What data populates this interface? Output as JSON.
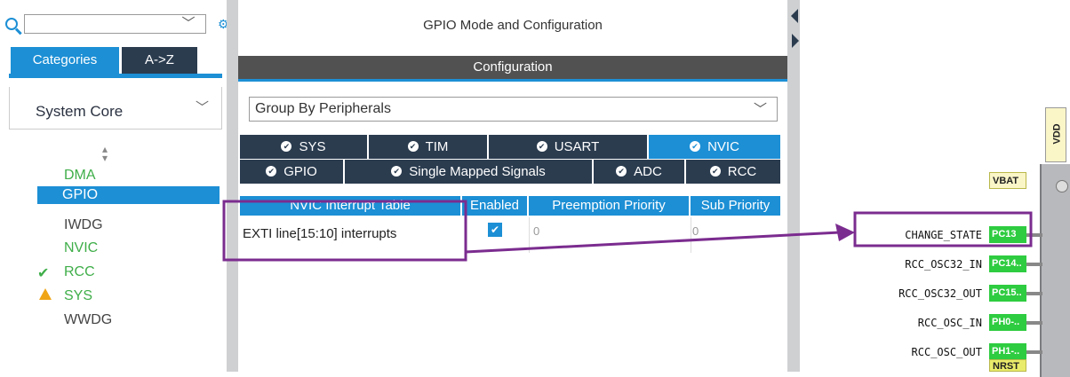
{
  "left_panel": {
    "tabs": {
      "categories": "Categories",
      "az": "A->Z"
    },
    "category_dropdown": "System Core",
    "items": [
      {
        "label": "DMA",
        "status": "none"
      },
      {
        "label": "GPIO",
        "status": "selected"
      },
      {
        "label": "IWDG",
        "status": "none"
      },
      {
        "label": "NVIC",
        "status": "none"
      },
      {
        "label": "RCC",
        "status": "ok"
      },
      {
        "label": "SYS",
        "status": "warning"
      },
      {
        "label": "WWDG",
        "status": "none"
      }
    ]
  },
  "main": {
    "title": "GPIO Mode and Configuration",
    "config_header": "Configuration",
    "group_by": "Group By Peripherals",
    "tabs_row1": [
      "SYS",
      "TIM",
      "USART",
      "NVIC"
    ],
    "tabs_row2": [
      "GPIO",
      "Single Mapped Signals",
      "ADC",
      "RCC"
    ],
    "active_tab": "NVIC",
    "table": {
      "columns": [
        "NVIC Interrupt Table",
        "Enabled",
        "Preemption Priority",
        "Sub Priority"
      ],
      "rows": [
        {
          "name": "EXTI line[15:10] interrupts",
          "enabled": true,
          "preemption": "0",
          "sub": "0"
        }
      ]
    }
  },
  "pinout": {
    "vdd": "VDD",
    "pins": [
      {
        "signal": "",
        "pin": "VBAT",
        "color": "cream"
      },
      {
        "signal": "CHANGE_STATE",
        "pin": "PC13",
        "color": "green"
      },
      {
        "signal": "RCC_OSC32_IN",
        "pin": "PC14..",
        "color": "green"
      },
      {
        "signal": "RCC_OSC32_OUT",
        "pin": "PC15..",
        "color": "green"
      },
      {
        "signal": "RCC_OSC_IN",
        "pin": "PH0-..",
        "color": "green"
      },
      {
        "signal": "RCC_OSC_OUT",
        "pin": "PH1-..",
        "color": "green"
      },
      {
        "signal": "",
        "pin": "NRST",
        "color": "yellow"
      }
    ]
  },
  "colors": {
    "accent": "#1c8fd5",
    "annotation": "#7b2c8f",
    "ok": "#3fae49",
    "warning": "#f0a516"
  }
}
